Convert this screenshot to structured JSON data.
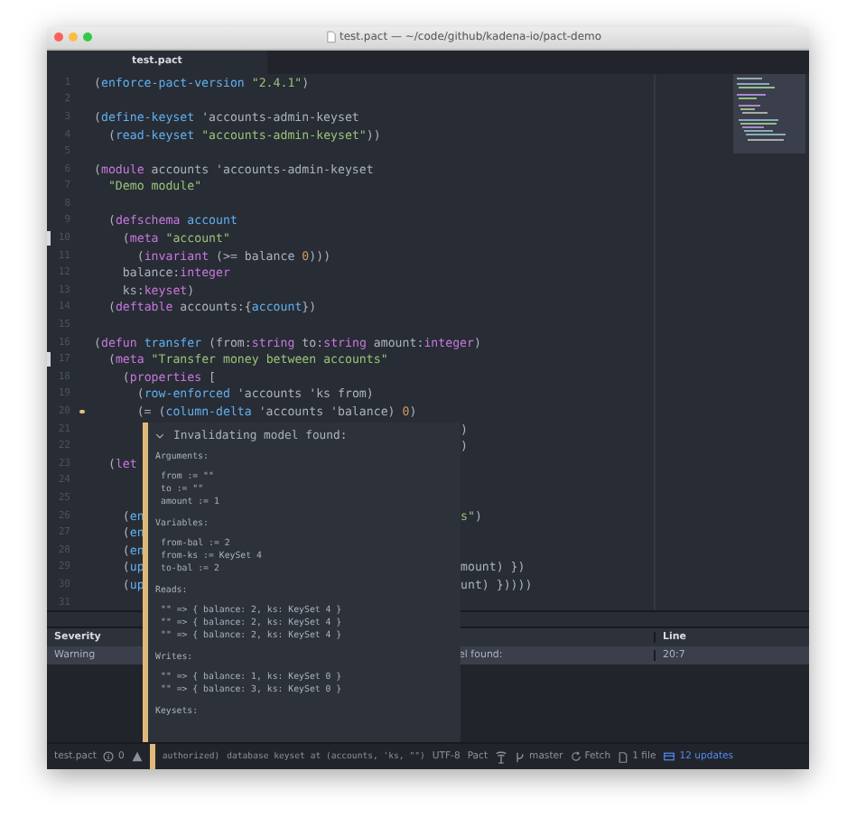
{
  "window": {
    "title": "test.pact — ~/code/github/kadena-io/pact-demo"
  },
  "tabs": [
    {
      "label": "test.pact",
      "selected": true
    }
  ],
  "editor": {
    "lines": [
      {
        "n": "1",
        "code": [
          {
            "text": "(",
            "kind": "plain"
          },
          {
            "text": "enforce-pact-version ",
            "kind": "function"
          },
          {
            "text": "\"2.4.1\"",
            "kind": "string"
          },
          {
            "text": ")",
            "kind": "plain"
          }
        ]
      },
      {
        "n": "2"
      },
      {
        "n": "3",
        "code": [
          {
            "text": "(",
            "kind": "plain"
          },
          {
            "text": "define-keyset",
            "kind": "function"
          },
          {
            "text": " 'accounts-admin-keyset",
            "kind": "plain"
          }
        ]
      },
      {
        "n": "4",
        "code": [
          {
            "text": "  (",
            "kind": "plain"
          },
          {
            "text": "read-keyset ",
            "kind": "function"
          },
          {
            "text": "\"accounts-admin-keyset\"",
            "kind": "string"
          },
          {
            "text": "))",
            "kind": "plain"
          }
        ]
      },
      {
        "n": "5"
      },
      {
        "n": "6",
        "code": [
          {
            "text": "(",
            "kind": "plain"
          },
          {
            "text": "module",
            "kind": "keyword"
          },
          {
            "text": " accounts 'accounts-admin-keyset",
            "kind": "plain"
          }
        ]
      },
      {
        "n": "7",
        "code": [
          {
            "text": "  \"Demo module\"",
            "kind": "string"
          }
        ]
      },
      {
        "n": "8"
      },
      {
        "n": "9",
        "code": [
          {
            "text": "  (",
            "kind": "plain"
          },
          {
            "text": "defschema ",
            "kind": "keyword"
          },
          {
            "text": "account",
            "kind": "function"
          }
        ]
      },
      {
        "n": "10",
        "modified": true,
        "code": [
          {
            "text": "    (",
            "kind": "plain"
          },
          {
            "text": "meta ",
            "kind": "keyword"
          },
          {
            "text": "\"account\"",
            "kind": "string"
          }
        ]
      },
      {
        "n": "11",
        "code": [
          {
            "text": "      (",
            "kind": "plain"
          },
          {
            "text": "invariant",
            "kind": "keyword"
          },
          {
            "text": " (>= balance ",
            "kind": "plain"
          },
          {
            "text": "0",
            "kind": "number"
          },
          {
            "text": ")))",
            "kind": "plain"
          }
        ]
      },
      {
        "n": "12",
        "code": [
          {
            "text": "    balance:",
            "kind": "plain"
          },
          {
            "text": "integer",
            "kind": "keyword"
          }
        ]
      },
      {
        "n": "13",
        "code": [
          {
            "text": "    ks:",
            "kind": "plain"
          },
          {
            "text": "keyset",
            "kind": "keyword"
          },
          {
            "text": ")",
            "kind": "plain"
          }
        ]
      },
      {
        "n": "14",
        "code": [
          {
            "text": "  (",
            "kind": "plain"
          },
          {
            "text": "deftable",
            "kind": "keyword"
          },
          {
            "text": " accounts:{",
            "kind": "plain"
          },
          {
            "text": "account",
            "kind": "function"
          },
          {
            "text": "})",
            "kind": "plain"
          }
        ]
      },
      {
        "n": "15"
      },
      {
        "n": "16",
        "code": [
          {
            "text": "(",
            "kind": "plain"
          },
          {
            "text": "defun ",
            "kind": "keyword"
          },
          {
            "text": "transfer",
            "kind": "function"
          },
          {
            "text": " (from:",
            "kind": "plain"
          },
          {
            "text": "string",
            "kind": "keyword"
          },
          {
            "text": " to:",
            "kind": "plain"
          },
          {
            "text": "string",
            "kind": "keyword"
          },
          {
            "text": " amount:",
            "kind": "plain"
          },
          {
            "text": "integer",
            "kind": "keyword"
          },
          {
            "text": ")",
            "kind": "plain"
          }
        ]
      },
      {
        "n": "17",
        "modified": true,
        "code": [
          {
            "text": "  (",
            "kind": "plain"
          },
          {
            "text": "meta ",
            "kind": "keyword"
          },
          {
            "text": "\"Transfer money between accounts\"",
            "kind": "string"
          }
        ]
      },
      {
        "n": "18",
        "code": [
          {
            "text": "    (",
            "kind": "plain"
          },
          {
            "text": "properties",
            "kind": "keyword"
          },
          {
            "text": " [",
            "kind": "plain"
          }
        ]
      },
      {
        "n": "19",
        "code": [
          {
            "text": "      (",
            "kind": "plain"
          },
          {
            "text": "row-enforced",
            "kind": "function"
          },
          {
            "text": " 'accounts 'ks from)",
            "kind": "plain"
          }
        ]
      },
      {
        "n": "20",
        "warning": true,
        "code": [
          {
            "text": "      (= (",
            "kind": "plain"
          },
          {
            "text": "column-delta",
            "kind": "function"
          },
          {
            "text": " 'accounts 'balance) ",
            "kind": "plain"
          },
          {
            "text": "0",
            "kind": "number"
          },
          {
            "text": ")",
            "kind": "plain"
          }
        ]
      },
      {
        "n": "21",
        "tail": [
          {
            "text": ")",
            "kind": "plain"
          }
        ]
      },
      {
        "n": "22",
        "tail": [
          {
            "text": ")",
            "kind": "plain"
          }
        ]
      },
      {
        "n": "23",
        "code": [
          {
            "text": "  (",
            "kind": "plain"
          },
          {
            "text": "let",
            "kind": "keyword"
          }
        ]
      },
      {
        "n": "24"
      },
      {
        "n": "25"
      },
      {
        "n": "26",
        "code": [
          {
            "text": "    (",
            "kind": "plain"
          },
          {
            "text": "en",
            "kind": "function"
          }
        ],
        "tail": [
          {
            "text": "s\"",
            "kind": "string"
          },
          {
            "text": ")",
            "kind": "plain"
          }
        ]
      },
      {
        "n": "27",
        "code": [
          {
            "text": "    (",
            "kind": "plain"
          },
          {
            "text": "en",
            "kind": "function"
          }
        ]
      },
      {
        "n": "28",
        "code": [
          {
            "text": "    (",
            "kind": "plain"
          },
          {
            "text": "en",
            "kind": "function"
          }
        ]
      },
      {
        "n": "29",
        "code": [
          {
            "text": "    (",
            "kind": "plain"
          },
          {
            "text": "up",
            "kind": "function"
          }
        ],
        "tail": [
          {
            "text": "mount) })",
            "kind": "plain"
          }
        ]
      },
      {
        "n": "30",
        "code": [
          {
            "text": "    (",
            "kind": "plain"
          },
          {
            "text": "up",
            "kind": "function"
          }
        ],
        "tail": [
          {
            "text": "unt) }))))",
            "kind": "plain"
          }
        ]
      },
      {
        "n": "31"
      }
    ]
  },
  "popup": {
    "title": "Invalidating model found:",
    "expanded": true,
    "sections": [
      {
        "heading": "Arguments:",
        "items": [
          "from := \"\"",
          "to := \"\"",
          "amount := 1"
        ]
      },
      {
        "heading": "Variables:",
        "items": [
          "from-bal := 2",
          "from-ks := KeySet 4",
          "to-bal := 2"
        ]
      },
      {
        "heading": "Reads:",
        "items": [
          "\"\" => { balance: 2, ks: KeySet 4 }",
          "\"\" => { balance: 2, ks: KeySet 4 }",
          "\"\" => { balance: 2, ks: KeySet 4 }"
        ]
      },
      {
        "heading": "Writes:",
        "items": [
          "\"\" => { balance: 1, ks: KeySet 0 }",
          "\"\" => { balance: 3, ks: KeySet 0 }"
        ]
      },
      {
        "heading": "Keysets:"
      }
    ]
  },
  "problems": {
    "header": {
      "severity": "Severity",
      "line": "Line"
    },
    "rows": [
      {
        "severity": "Warning",
        "description": "el found:",
        "line": "20:7",
        "selected": true
      }
    ]
  },
  "status_bar": {
    "file": "test.pact",
    "problems": "0",
    "message": "authorized)",
    "detail": "database keyset at (accounts, 'ks, \"\")",
    "encoding": "UTF-8",
    "grammar": "Pact",
    "branch": "master",
    "fetch": "Fetch",
    "changes": "1 file",
    "updates": "12 updates"
  }
}
